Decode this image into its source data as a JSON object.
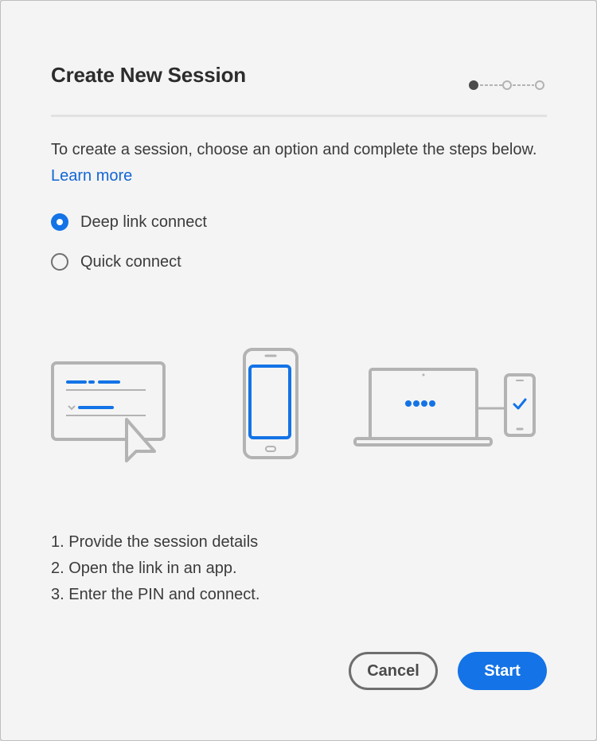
{
  "dialog": {
    "title": "Create New Session",
    "stepper": {
      "total_steps": 3,
      "current_step": 1
    },
    "description": "To create a session, choose an option and complete the steps below.",
    "learn_more": "Learn more",
    "options": [
      {
        "label": "Deep link connect",
        "selected": true
      },
      {
        "label": "Quick connect",
        "selected": false
      }
    ],
    "illustrations": [
      "form-cursor-icon",
      "smartphone-icon",
      "laptop-pin-phone-check-icon"
    ],
    "steps": [
      "1. Provide the session details",
      "2. Open the link in an app.",
      "3. Enter the PIN and connect."
    ],
    "buttons": {
      "cancel": "Cancel",
      "start": "Start"
    }
  },
  "colors": {
    "accent": "#1473e6",
    "link": "#1266d4",
    "background": "#f4f4f4",
    "illustration_gray": "#b3b3b3"
  }
}
